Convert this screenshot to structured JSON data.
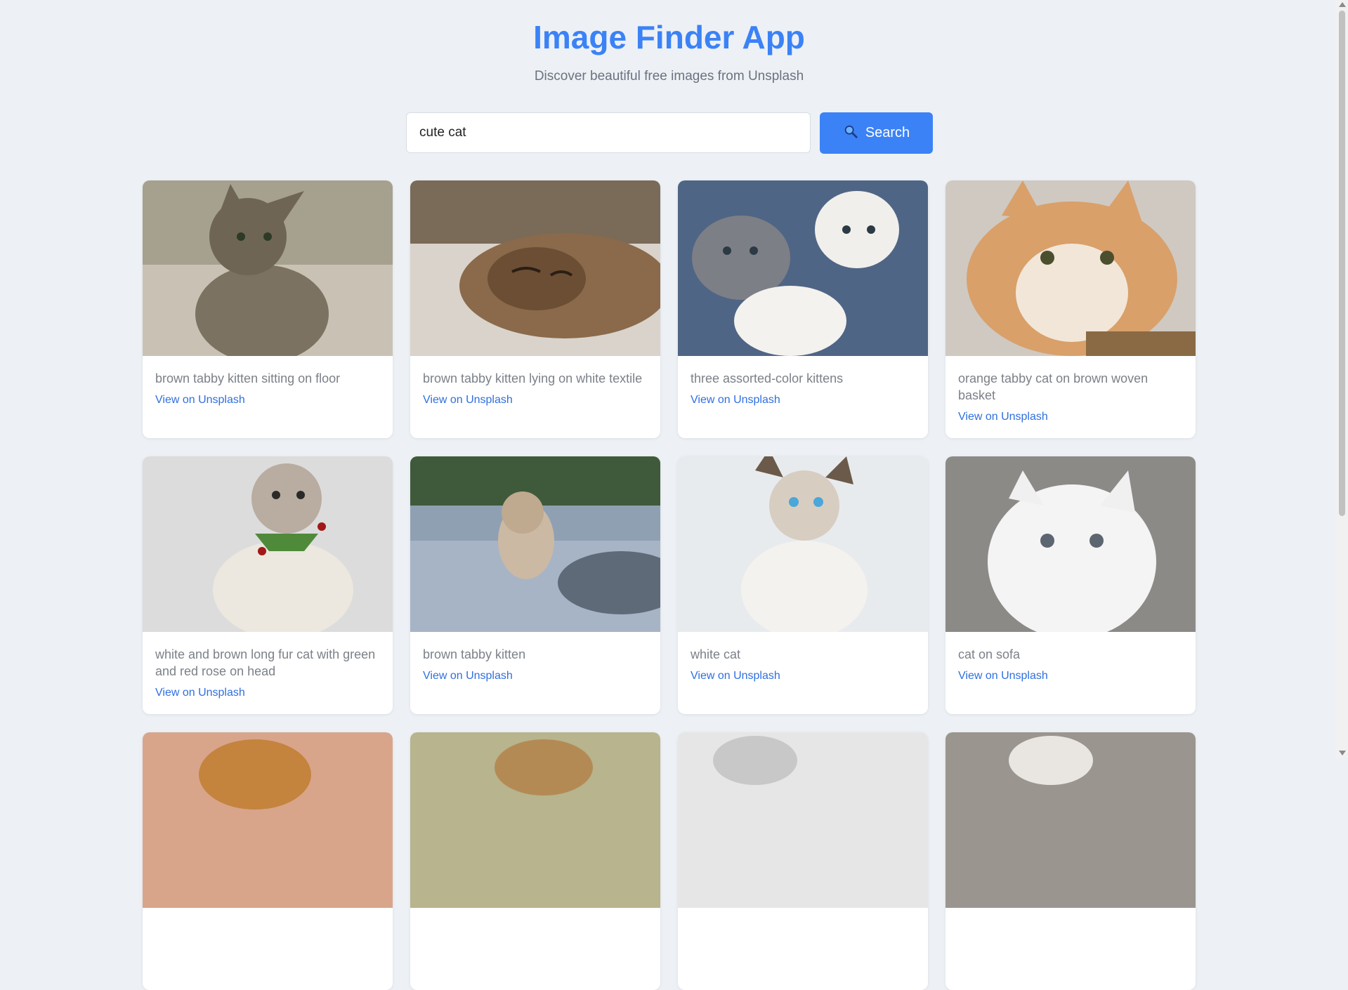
{
  "header": {
    "title": "Image Finder App",
    "subtitle": "Discover beautiful free images from Unsplash"
  },
  "search": {
    "value": "cute cat",
    "button_label": "Search",
    "icon": "magnifier-icon"
  },
  "colors": {
    "accent": "#3b82f6",
    "background": "#edf1f5",
    "link": "#2f6fdf"
  },
  "results": [
    {
      "caption": "brown tabby kitten sitting on floor",
      "link": "View on Unsplash"
    },
    {
      "caption": "brown tabby kitten lying on white textile",
      "link": "View on Unsplash"
    },
    {
      "caption": "three assorted-color kittens",
      "link": "View on Unsplash"
    },
    {
      "caption": "orange tabby cat on brown woven basket",
      "link": "View on Unsplash"
    },
    {
      "caption": "white and brown long fur cat with green and red rose on head",
      "link": "View on Unsplash"
    },
    {
      "caption": "brown tabby kitten",
      "link": "View on Unsplash"
    },
    {
      "caption": "white cat",
      "link": "View on Unsplash"
    },
    {
      "caption": "cat on sofa",
      "link": "View on Unsplash"
    },
    {
      "caption": "",
      "link": ""
    },
    {
      "caption": "",
      "link": ""
    },
    {
      "caption": "",
      "link": ""
    },
    {
      "caption": "",
      "link": ""
    }
  ]
}
